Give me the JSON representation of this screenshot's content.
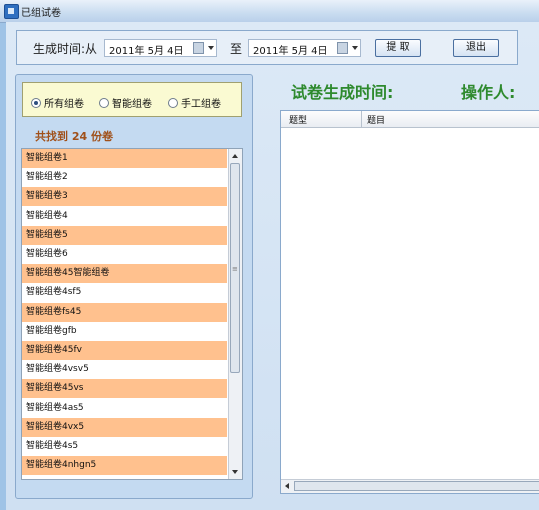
{
  "window": {
    "title": "已组试卷"
  },
  "toolbar": {
    "from_label": "生成时间:从",
    "start_date": "2011年 5月 4日",
    "to_label": "至",
    "end_date": "2011年 5月 4日",
    "fetch_label": "提  取",
    "exit_label": "退出"
  },
  "filter": {
    "options": [
      "所有组卷",
      "智能组卷",
      "手工组卷"
    ],
    "selected": "所有组卷"
  },
  "result_count": "共找到  24  份卷",
  "papers": [
    "智能组卷1",
    "智能组卷2",
    "智能组卷3",
    "智能组卷4",
    "智能组卷5",
    "智能组卷6",
    "智能组卷45智能组卷",
    "智能组卷4sf5",
    "智能组卷fs45",
    "智能组卷gfb",
    "智能组卷45fv",
    "智能组卷4vsv5",
    "智能组卷45vs",
    "智能组卷4as5",
    "智能组卷4vx5",
    "智能组卷4s5",
    "智能组卷4nhgn5"
  ],
  "detail": {
    "time_heading": "试卷生成时间:",
    "operator_heading": "操作人:",
    "columns": [
      "题型",
      "题目"
    ]
  },
  "colors": {
    "row_highlight": "#ffc18e",
    "heading": "#2e8a2e",
    "count": "#a0501a"
  }
}
